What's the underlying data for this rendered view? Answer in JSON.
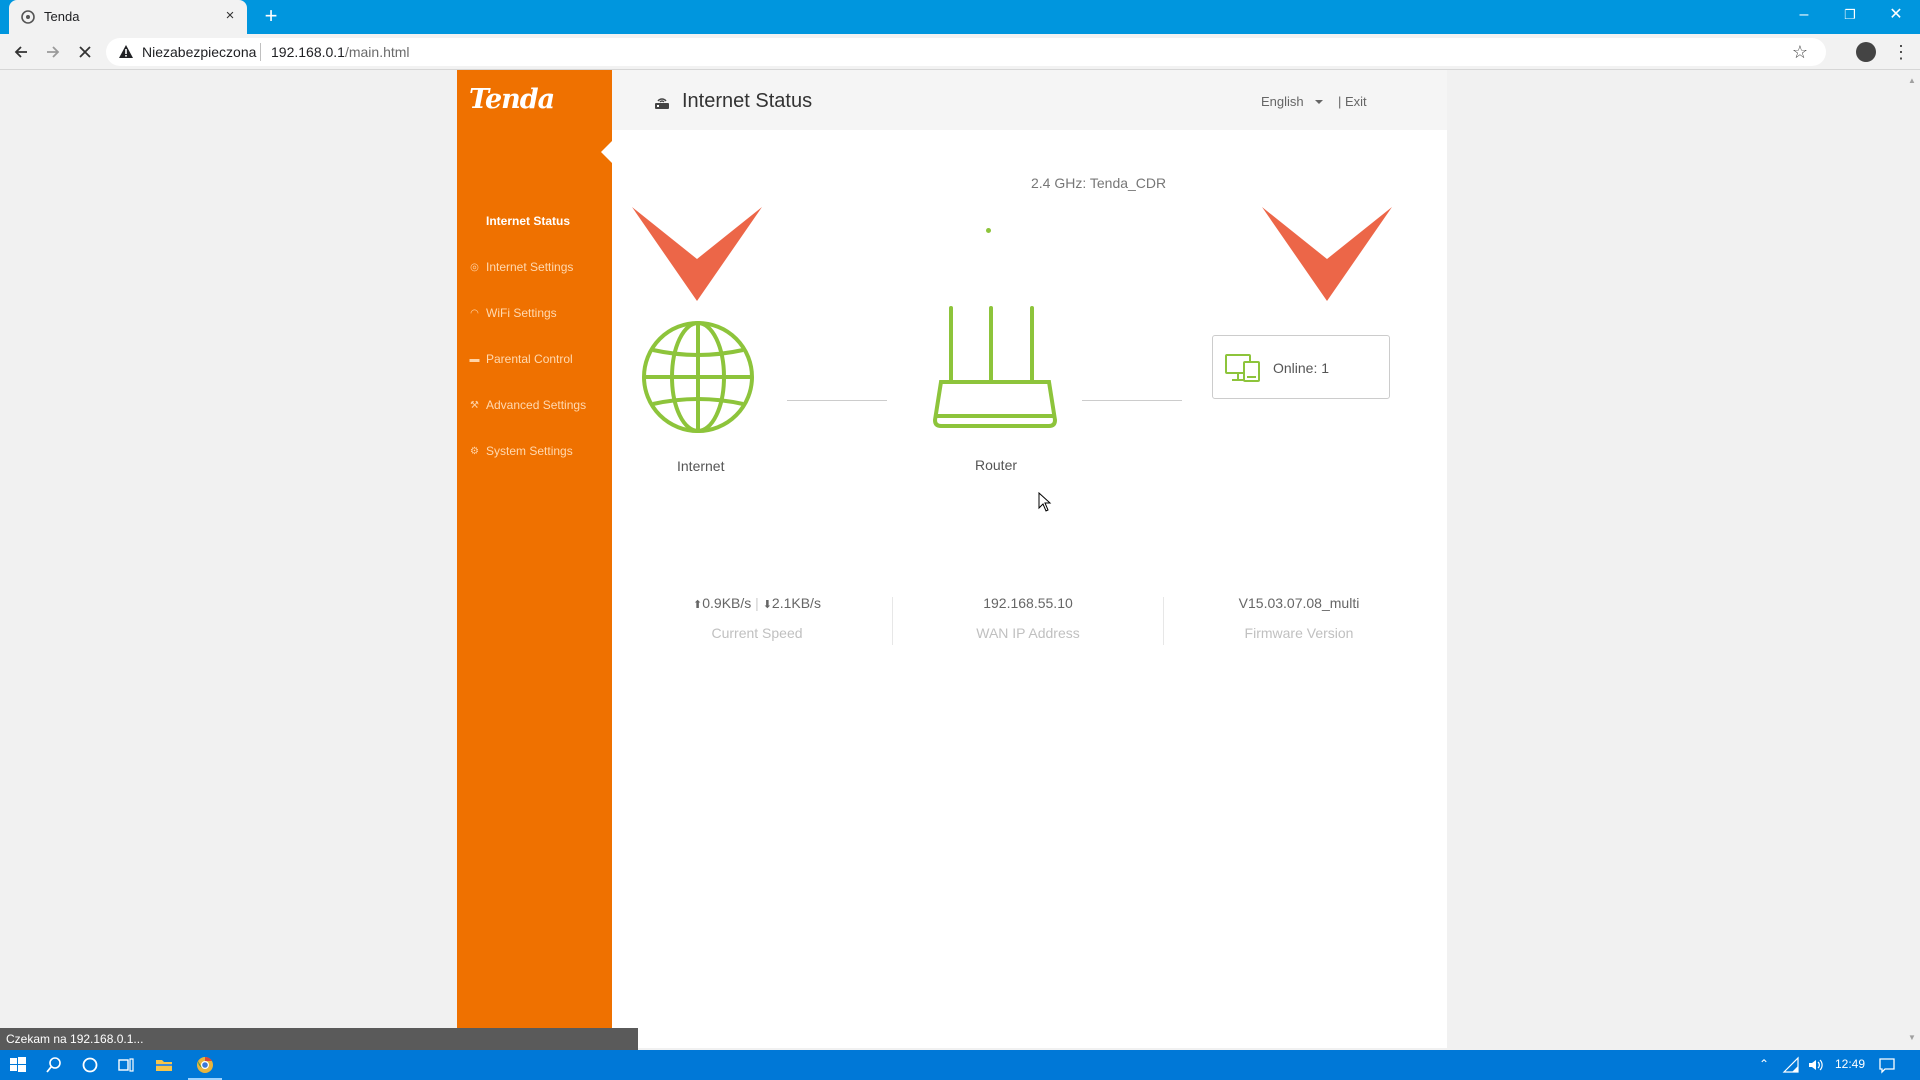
{
  "browser": {
    "tab_title": "Tenda",
    "tab_close": "×",
    "new_tab": "+",
    "security_label": "Niezabezpieczona",
    "url_host": "192.168.0.1",
    "url_path": "/main.html",
    "window": {
      "minimize": "–",
      "restore": "❐",
      "close": "✕"
    },
    "status_text": "Czekam na 192.168.0.1..."
  },
  "sidebar": {
    "logo": "Tenda",
    "items": [
      {
        "label": "Internet Status",
        "icon": "none",
        "active": true
      },
      {
        "label": "Internet Settings",
        "icon": "globe-icon"
      },
      {
        "label": "WiFi Settings",
        "icon": "wifi-icon"
      },
      {
        "label": "Parental Control",
        "icon": "parental-icon"
      },
      {
        "label": "Advanced Settings",
        "icon": "wrench-icon"
      },
      {
        "label": "System Settings",
        "icon": "gear-icon"
      }
    ]
  },
  "header": {
    "title": "Internet Status",
    "language": "English",
    "exit": "| Exit"
  },
  "status": {
    "ssid": "2.4 GHz: Tenda_CDR",
    "internet_label": "Internet",
    "router_label": "Router",
    "online_label": "Online:  1"
  },
  "info": {
    "speed_up": "0.9KB/s",
    "speed_sep": "|",
    "speed_down": "2.1KB/s",
    "speed_label": "Current Speed",
    "wan_ip": "192.168.55.10",
    "wan_label": "WAN IP Address",
    "firmware": "V15.03.07.08_multi",
    "firmware_label": "Firmware Version"
  },
  "taskbar": {
    "clock": "12:49"
  },
  "colors": {
    "sidebar": "#ef7100",
    "accent_green": "#8dc43b",
    "chevron": "#ec6648",
    "titlebar": "#0096de",
    "taskbar": "#0078d7"
  }
}
